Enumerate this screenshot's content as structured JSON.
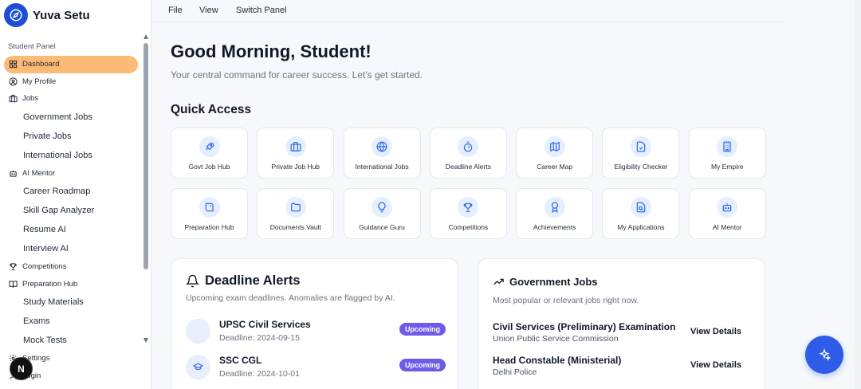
{
  "brand": {
    "name": "Yuva Setu"
  },
  "sidebar": {
    "panel_label": "Student Panel",
    "items": [
      {
        "label": "Dashboard",
        "icon": "grid-icon",
        "active": true
      },
      {
        "label": "My Profile",
        "icon": "user-circle-icon"
      },
      {
        "label": "Jobs",
        "icon": "briefcase-icon"
      },
      {
        "label": "Government Jobs",
        "sub": true
      },
      {
        "label": "Private Jobs",
        "sub": true
      },
      {
        "label": "International Jobs",
        "sub": true
      },
      {
        "label": "AI Mentor",
        "icon": "bot-icon"
      },
      {
        "label": "Career Roadmap",
        "sub": true
      },
      {
        "label": "Skill Gap Analyzer",
        "sub": true
      },
      {
        "label": "Resume AI",
        "sub": true
      },
      {
        "label": "Interview AI",
        "sub": true
      },
      {
        "label": "Competitions",
        "icon": "trophy-icon"
      },
      {
        "label": "Preparation Hub",
        "icon": "book-open-icon"
      },
      {
        "label": "Study Materials",
        "sub": true
      },
      {
        "label": "Exams",
        "sub": true
      },
      {
        "label": "Mock Tests",
        "sub": true
      },
      {
        "label": "Settings",
        "icon": "gear-icon"
      },
      {
        "label": "Login",
        "icon": "user-icon"
      }
    ]
  },
  "menubar": {
    "file": "File",
    "view": "View",
    "switch_panel": "Switch Panel"
  },
  "main": {
    "greeting": "Good Morning, Student!",
    "subtitle": "Your central command for career success. Let's get started.",
    "quick_access_title": "Quick Access",
    "tiles": [
      {
        "label": "Govt Job Hub",
        "icon": "rocket-icon"
      },
      {
        "label": "Private Job Hub",
        "icon": "briefcase-icon"
      },
      {
        "label": "International Jobs",
        "icon": "globe-icon"
      },
      {
        "label": "Deadline Alerts",
        "icon": "timer-icon"
      },
      {
        "label": "Career Map",
        "icon": "map-icon"
      },
      {
        "label": "Eligibility Checker",
        "icon": "file-check-icon"
      },
      {
        "label": "My Empire",
        "icon": "building-icon"
      },
      {
        "label": "Preparation Hub",
        "icon": "book-open-icon"
      },
      {
        "label": "Documents Vault",
        "icon": "folder-icon"
      },
      {
        "label": "Guidance Guru",
        "icon": "lightbulb-icon"
      },
      {
        "label": "Competitions",
        "icon": "trophy-icon"
      },
      {
        "label": "Achievements",
        "icon": "award-icon"
      },
      {
        "label": "My Applications",
        "icon": "file-search-icon"
      },
      {
        "label": "AI Mentor",
        "icon": "bot-icon"
      }
    ]
  },
  "deadlines": {
    "title": "Deadline Alerts",
    "subtitle": "Upcoming exam deadlines. Anomalies are flagged by AI.",
    "rows": [
      {
        "name": "UPSC Civil Services",
        "date": "Deadline: 2024-09-15",
        "status": "Upcoming"
      },
      {
        "name": "SSC CGL",
        "date": "Deadline: 2024-10-01",
        "status": "Upcoming"
      }
    ]
  },
  "govt_jobs": {
    "title": "Government Jobs",
    "subtitle": "Most popular or relevant jobs right now.",
    "rows": [
      {
        "title": "Civil Services (Preliminary) Examination",
        "org": "Union Public Service Commission",
        "action": "View Details"
      },
      {
        "title": "Head Constable (Ministerial)",
        "org": "Delhi Police",
        "action": "View Details"
      }
    ]
  },
  "colors": {
    "accent": "#2563eb",
    "active_nav": "#fdba74",
    "badge": "#6d5ce7"
  },
  "floating": {
    "avatar_letter": "N"
  }
}
